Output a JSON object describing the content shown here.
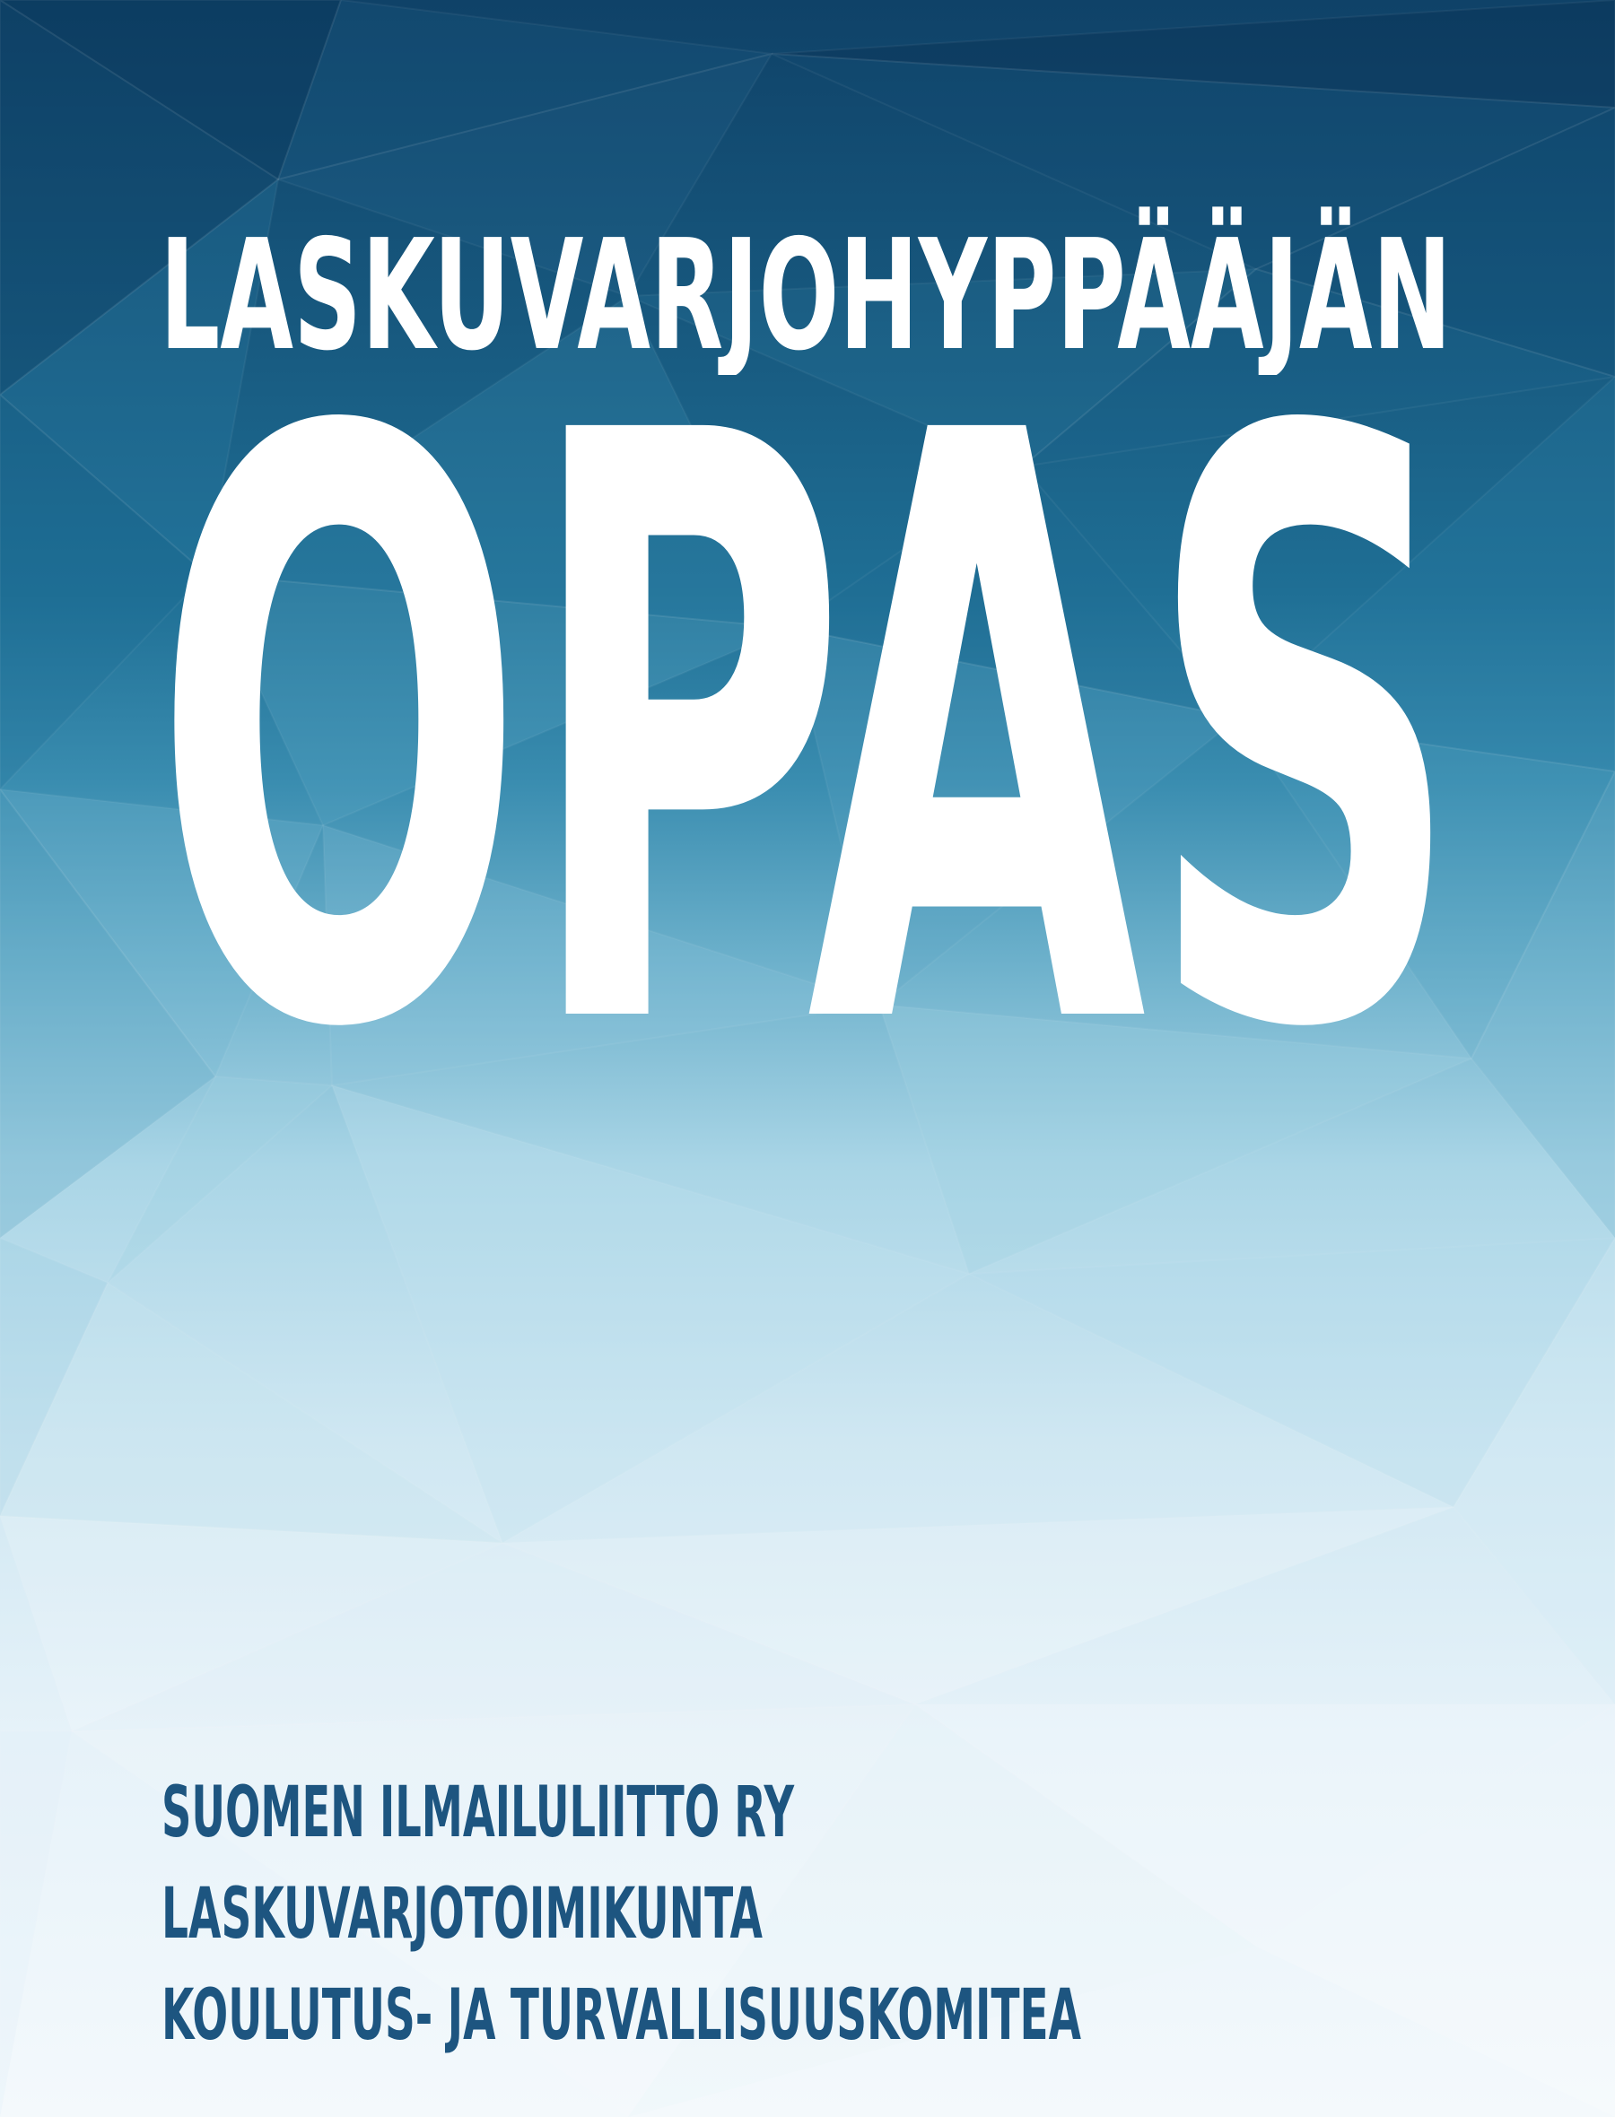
{
  "cover": {
    "subtitle": "LASKUVARJOHYPPÄÄJÄN",
    "title": "OPAS",
    "publisher_lines": [
      "SUOMEN ILMAILULIITTO RY",
      "LASKUVARJOTOIMIKUNTA",
      "KOULUTUS- JA TURVALLISUUSKOMITEA"
    ]
  },
  "colors": {
    "background_top": "#0f4268",
    "background_mid": "#2a7fa6",
    "background_light": "#9ed0e2",
    "background_bottom": "#f2f8fc",
    "heading_text": "#ffffff",
    "publisher_text": "#1d5580"
  }
}
